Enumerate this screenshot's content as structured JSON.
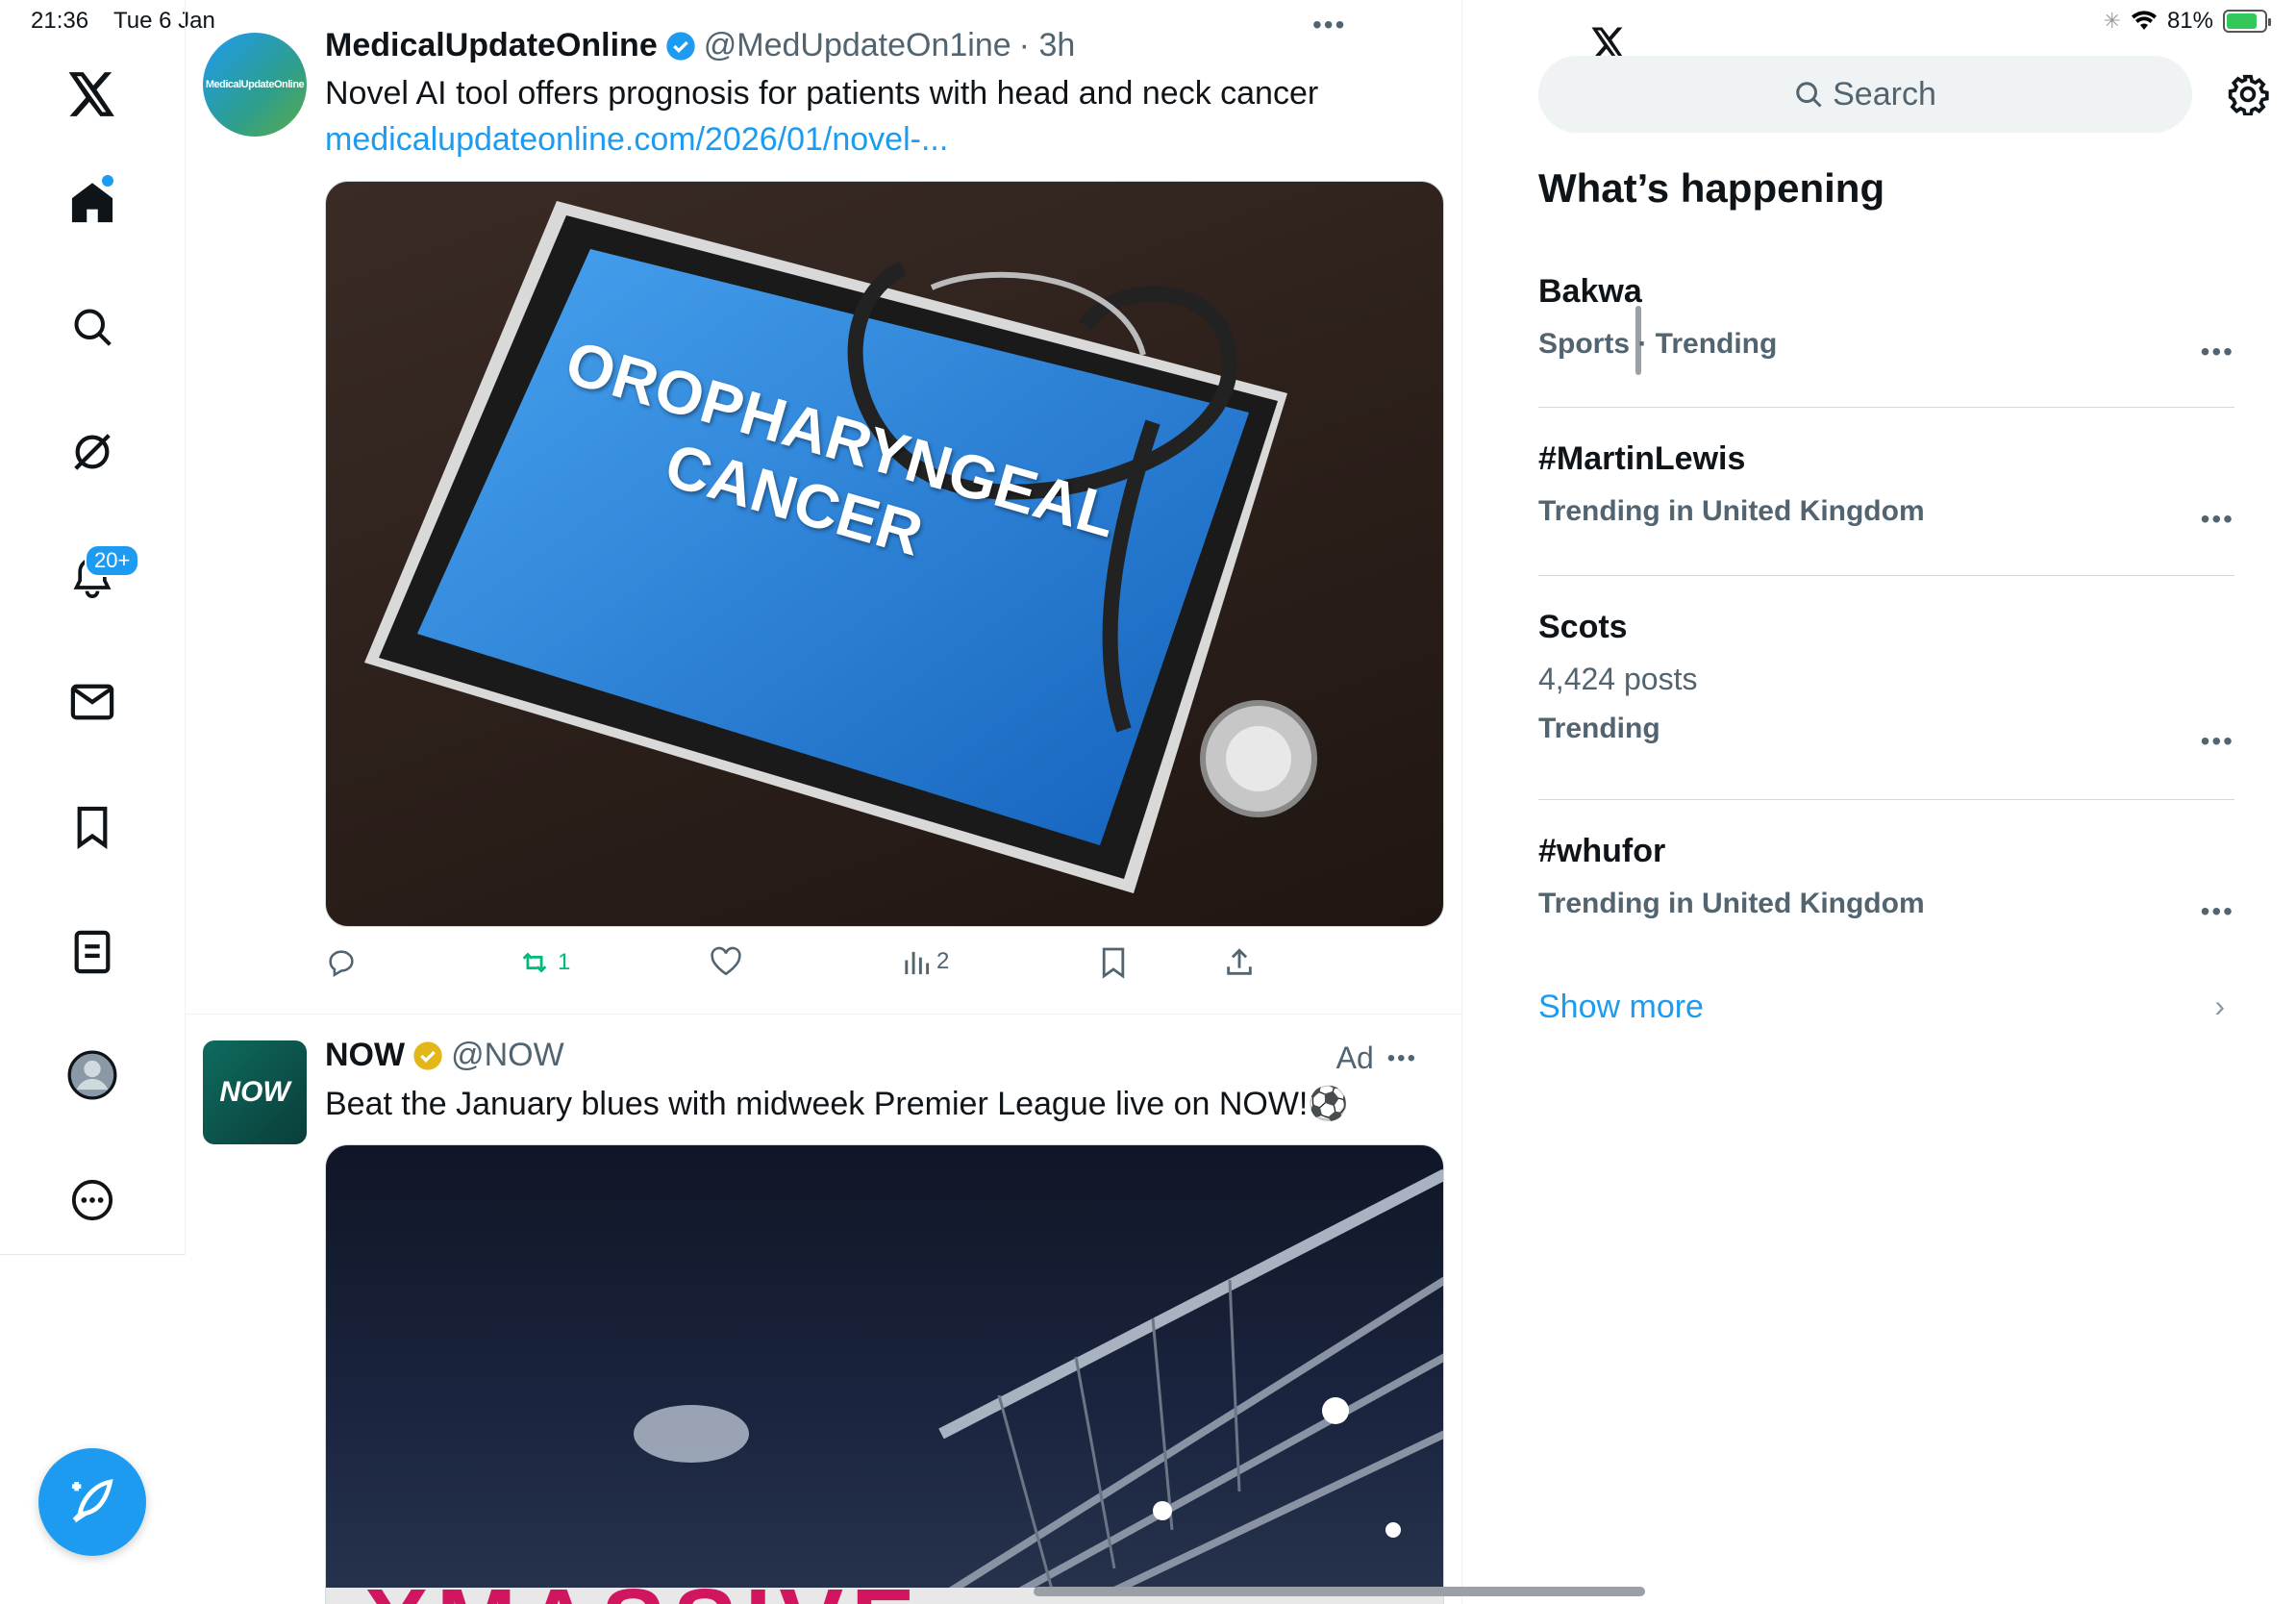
{
  "status_bar": {
    "time": "21:36",
    "date": "Tue 6 Jan",
    "battery": "81%",
    "battery_level": 0.81
  },
  "nav": {
    "items": [
      {
        "icon": "x-logo-icon"
      },
      {
        "icon": "home-icon",
        "has_dot": true
      },
      {
        "icon": "search-icon"
      },
      {
        "icon": "grok-icon"
      },
      {
        "icon": "notifications-icon",
        "badge": "20+"
      },
      {
        "icon": "messages-icon"
      },
      {
        "icon": "bookmarks-icon"
      },
      {
        "icon": "lists-icon"
      },
      {
        "icon": "profile-icon"
      },
      {
        "icon": "more-icon"
      }
    ],
    "notifications_badge": "20+",
    "compose_icon": "compose-icon"
  },
  "feed": {
    "post1": {
      "avatar_text": "MedicalUpdateOnline",
      "name": "MedicalUpdateOnline",
      "handle": "@MedUpdateOn1ine",
      "time": "· 3h",
      "text": "Novel AI tool offers prognosis for patients with head and neck cancer",
      "link": "medicalupdateonline.com/2026/01/novel-...",
      "image_text_line1": "OROPHARYNGEAL",
      "image_text_line2": "CANCER",
      "retweets": "1",
      "views": "2"
    },
    "post2": {
      "avatar_text": "NOW",
      "name": "NOW",
      "handle": "@NOW",
      "ad_label": "Ad",
      "text": "Beat the January blues with midweek Premier League live on NOW!⚽",
      "image_text": "XMASSIVE"
    }
  },
  "right": {
    "search_placeholder": "Search",
    "section_title": "What’s happening",
    "trends": [
      {
        "title": "Bakwa",
        "sub": "Sports · Trending"
      },
      {
        "title": "#MartinLewis",
        "sub": "Trending in United Kingdom"
      },
      {
        "title": "Scots",
        "count": "4,424 posts",
        "sub": "Trending"
      },
      {
        "title": "#whufor",
        "sub": "Trending in United Kingdom"
      }
    ],
    "show_more": "Show more"
  },
  "colors": {
    "accent": "#1d9bf0",
    "retweet_green": "#00ba7c",
    "muted": "#536471"
  }
}
